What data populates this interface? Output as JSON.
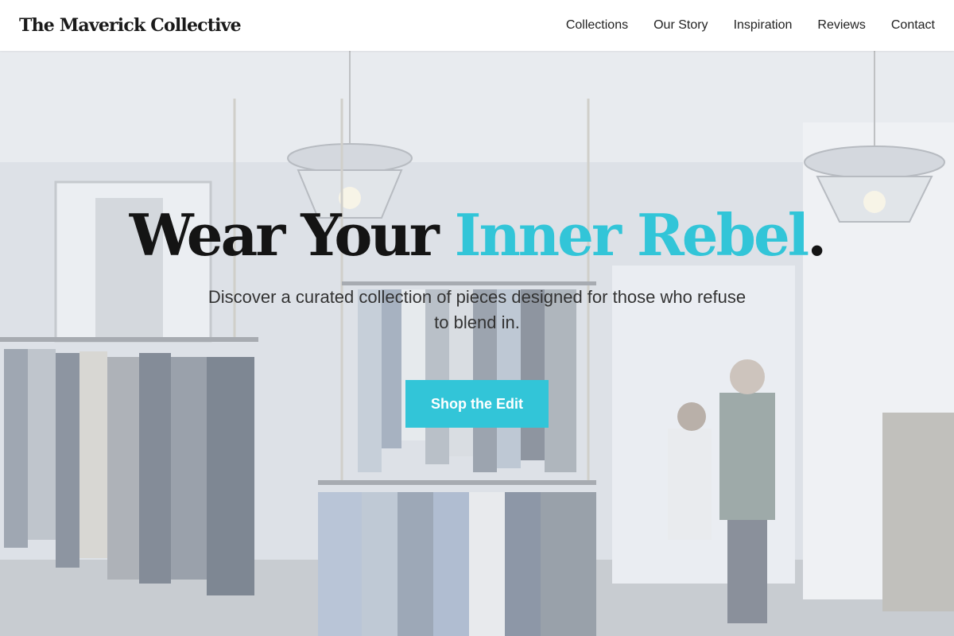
{
  "header": {
    "brand": "The Maverick Collective",
    "nav": [
      "Collections",
      "Our Story",
      "Inspiration",
      "Reviews",
      "Contact"
    ]
  },
  "hero": {
    "headline_main": "Wear Your ",
    "headline_accent": "Inner Rebel",
    "headline_end": ".",
    "subhead": "Discover a curated collection of pieces designed for those who refuse to blend in.",
    "cta_label": "Shop the Edit",
    "background": "clothing-store-photo"
  },
  "colors": {
    "accent": "#32c5d8",
    "text_dark": "#141414",
    "header_bg": "#ffffff"
  }
}
